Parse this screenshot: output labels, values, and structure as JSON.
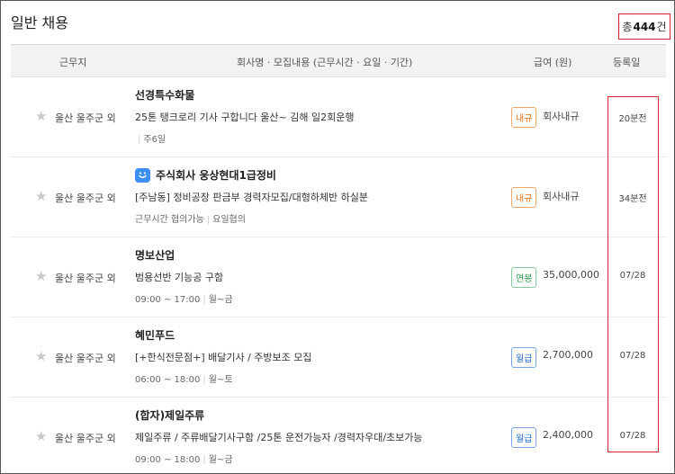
{
  "header": {
    "title": "일반 채용",
    "total_prefix": "총",
    "total_count": "444",
    "total_suffix": "건"
  },
  "columns": {
    "location": "근무지",
    "company": "회사명 · 모집내용 (근무시간 · 요일 · 기간)",
    "pay": "급여 (원)",
    "date": "등록일"
  },
  "colors": {
    "highlight": "#d9262c",
    "badge_orange": "#e0700f",
    "badge_green": "#2f9c4c",
    "badge_blue": "#2a6fd6",
    "company_icon": "#3d8ef7"
  },
  "rows": [
    {
      "favorite_icon": "star-icon",
      "location": "울산 울주군 외",
      "company": "선경특수화물",
      "description": "25톤 탱크로리 기사 구합니다 울산~ 김해 일2회운행",
      "conditions": [
        "주6일"
      ],
      "pay_badge": "내규",
      "pay": "회사내규",
      "date": "20분전"
    },
    {
      "favorite_icon": "star-icon",
      "company_icon": "smile-icon",
      "location": "울산 울주군 외",
      "company": "주식회사 웅상현대1급정비",
      "description": "[주남동] 정비공장 판금부 경력자모집/대형하체반 하실분",
      "conditions": [
        "근무시간 협의가능",
        "요일협의"
      ],
      "pay_badge": "내규",
      "pay": "회사내규",
      "date": "34분전"
    },
    {
      "favorite_icon": "star-icon",
      "location": "울산 울주군 외",
      "company": "명보산업",
      "description": "범용선반 기능공 구함",
      "conditions": [
        "09:00 ~ 17:00",
        "월~금"
      ],
      "pay_badge": "연봉",
      "pay": "35,000,000",
      "date": "07/28"
    },
    {
      "favorite_icon": "star-icon",
      "location": "울산 울주군 외",
      "company": "혜민푸드",
      "description": "[+한식전문점+] 배달기사 / 주방보조 모집",
      "conditions": [
        "06:00 ~ 18:00",
        "월~토"
      ],
      "pay_badge": "월급",
      "pay": "2,700,000",
      "date": "07/28"
    },
    {
      "favorite_icon": "star-icon",
      "location": "울산 울주군 외",
      "company": "(합자)제일주류",
      "description": "제일주류 / 주류배달기사구함 /25톤 운전가능자 /경력자우대/초보가능",
      "conditions": [
        "09:00 ~ 18:00",
        "월~금"
      ],
      "pay_badge": "월급",
      "pay": "2,400,000",
      "date": "07/28"
    }
  ]
}
